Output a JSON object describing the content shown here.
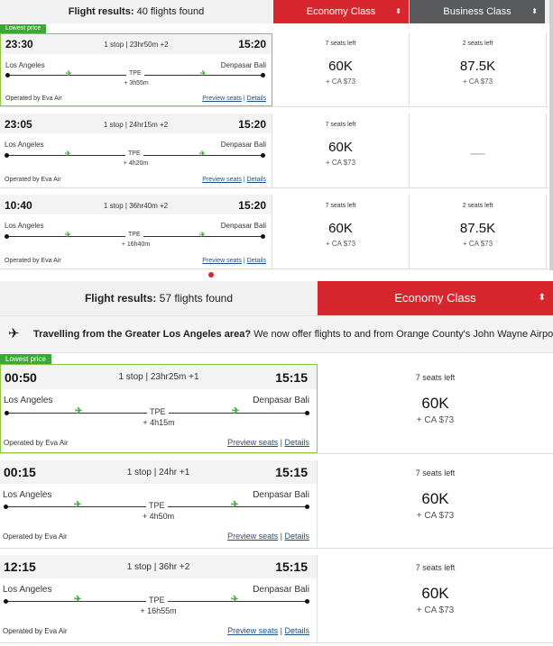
{
  "section1": {
    "results_label": "Flight results:",
    "results_count": "40 flights found",
    "cabins": [
      {
        "label": "Economy Class",
        "arrows": "⬍"
      },
      {
        "label": "Business Class",
        "arrows": "⬍"
      }
    ],
    "badge": "Lowest price",
    "flights": [
      {
        "dep": "23:30",
        "stops": "1 stop | 23hr50m +2",
        "arr": "15:20",
        "from": "Los Angeles",
        "to": "Denpasar Bali",
        "via": "TPE",
        "layover": "+ 3h55m",
        "operator": "Operated by Eva Air",
        "preview": "Preview seats",
        "sep": "|",
        "details": "Details",
        "eco": {
          "seats": "7 seats left",
          "points": "60K",
          "tax": "+ CA $73"
        },
        "bus": {
          "seats": "2 seats left",
          "points": "87.5K",
          "tax": "+ CA $73"
        }
      },
      {
        "dep": "23:05",
        "stops": "1 stop | 24hr15m +2",
        "arr": "15:20",
        "from": "Los Angeles",
        "to": "Denpasar Bali",
        "via": "TPE",
        "layover": "+ 4h20m",
        "operator": "Operated by Eva Air",
        "preview": "Preview seats",
        "sep": "|",
        "details": "Details",
        "eco": {
          "seats": "7 seats left",
          "points": "60K",
          "tax": "+ CA $73"
        },
        "bus": {
          "dash": "—"
        }
      },
      {
        "dep": "10:40",
        "stops": "1 stop | 36hr40m +2",
        "arr": "15:20",
        "from": "Los Angeles",
        "to": "Denpasar Bali",
        "via": "TPE",
        "layover": "+ 16h40m",
        "operator": "Operated by Eva Air",
        "preview": "Preview seats",
        "sep": "|",
        "details": "Details",
        "eco": {
          "seats": "7 seats left",
          "points": "60K",
          "tax": "+ CA $73"
        },
        "bus": {
          "seats": "2 seats left",
          "points": "87.5K",
          "tax": "+ CA $73"
        }
      }
    ]
  },
  "section2": {
    "results_label": "Flight results:",
    "results_count": "57 flights found",
    "cabin": {
      "label": "Economy Class",
      "arrows": "⬍"
    },
    "notice_bold": "Travelling from the Greater Los Angeles area?",
    "notice_text": " We now offer flights to and from Orange County's John Wayne Airport (SNA).",
    "notice_icon": "airplane-icon",
    "badge": "Lowest price",
    "flights": [
      {
        "dep": "00:50",
        "stops": "1 stop | 23hr25m +1",
        "arr": "15:15",
        "from": "Los Angeles",
        "to": "Denpasar Bali",
        "via": "TPE",
        "layover": "+ 4h15m",
        "operator": "Operated by Eva Air",
        "preview": "Preview seats",
        "sep": "|",
        "details": "Details",
        "eco": {
          "seats": "7 seats left",
          "points": "60K",
          "tax": "+ CA $73"
        }
      },
      {
        "dep": "00:15",
        "stops": "1 stop | 24hr +1",
        "arr": "15:15",
        "from": "Los Angeles",
        "to": "Denpasar Bali",
        "via": "TPE",
        "layover": "+ 4h50m",
        "operator": "Operated by Eva Air",
        "preview": "Preview seats",
        "sep": "|",
        "details": "Details",
        "eco": {
          "seats": "7 seats left",
          "points": "60K",
          "tax": "+ CA $73"
        }
      },
      {
        "dep": "12:15",
        "stops": "1 stop | 36hr +2",
        "arr": "15:15",
        "from": "Los Angeles",
        "to": "Denpasar Bali",
        "via": "TPE",
        "layover": "+ 16h55m",
        "operator": "Operated by Eva Air",
        "preview": "Preview seats",
        "sep": "|",
        "details": "Details",
        "eco": {
          "seats": "7 seats left",
          "points": "60K",
          "tax": "+ CA $73"
        }
      }
    ]
  },
  "colors": {
    "economy": "#d8262e",
    "business": "#58595b",
    "badge": "#39a935",
    "link": "#1a4f8b"
  }
}
